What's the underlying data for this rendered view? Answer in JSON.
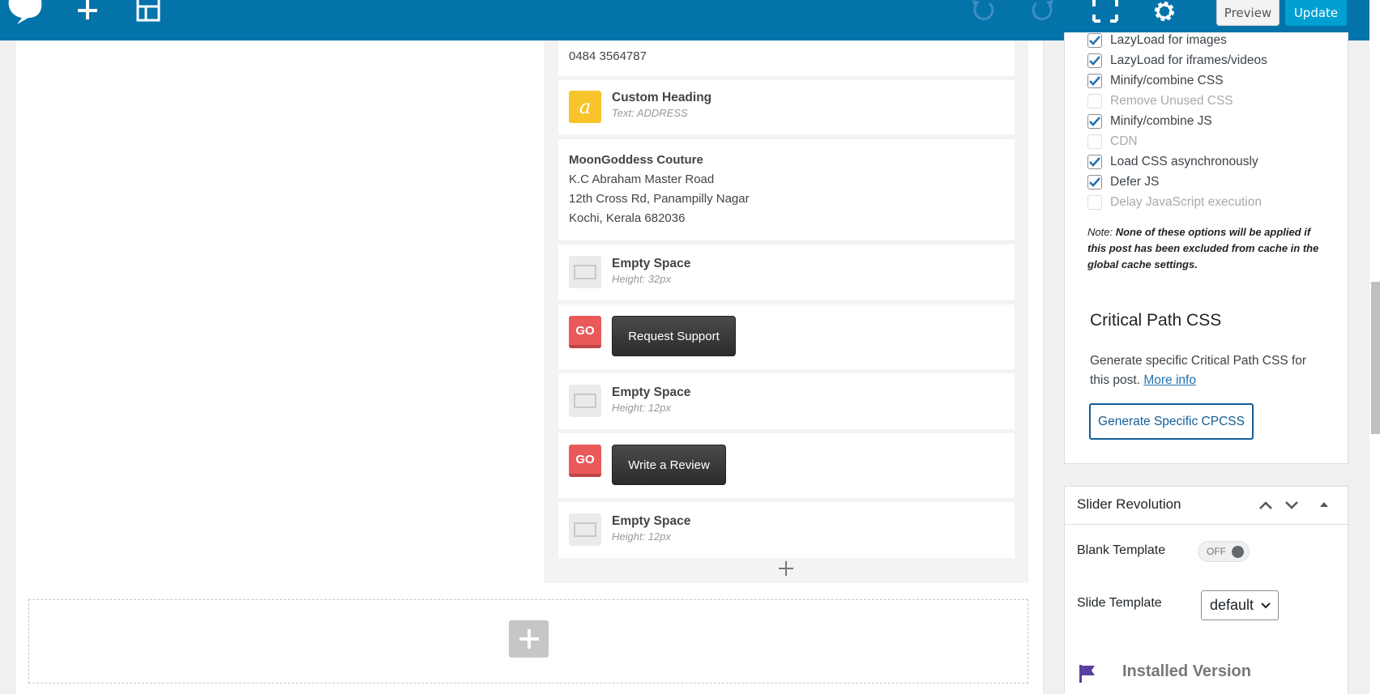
{
  "toolbar": {
    "preview_label": "Preview",
    "update_label": "Update",
    "icons": [
      "logo-icon",
      "add-element-icon",
      "templates-icon",
      "undo-icon",
      "redo-icon",
      "fullscreen-icon",
      "settings-icon"
    ]
  },
  "elements": {
    "phone_text": "0484 3564787",
    "custom_heading": {
      "title": "Custom Heading",
      "sub": "Text: ADDRESS",
      "icon_glyph": "a"
    },
    "address": {
      "line1": "MoonGoddess Couture",
      "line2": "K.C Abraham Master Road",
      "line3": "12th Cross Rd, Panampilly Nagar",
      "line4": "Kochi, Kerala 682036"
    },
    "space1": {
      "title": "Empty Space",
      "sub": "Height: 32px"
    },
    "btn_request": {
      "icon_label": "GO",
      "label": "Request Support"
    },
    "space2": {
      "title": "Empty Space",
      "sub": "Height: 12px"
    },
    "btn_review": {
      "icon_label": "GO",
      "label": "Write a Review"
    },
    "space3": {
      "title": "Empty Space",
      "sub": "Height: 12px"
    }
  },
  "sidebar": {
    "options": [
      {
        "label": "LazyLoad for images",
        "checked": true,
        "disabled": false
      },
      {
        "label": "LazyLoad for iframes/videos",
        "checked": true,
        "disabled": false
      },
      {
        "label": "Minify/combine CSS",
        "checked": true,
        "disabled": false
      },
      {
        "label": "Remove Unused CSS",
        "checked": false,
        "disabled": true
      },
      {
        "label": "Minify/combine JS",
        "checked": true,
        "disabled": false
      },
      {
        "label": "CDN",
        "checked": false,
        "disabled": true
      },
      {
        "label": "Load CSS asynchronously",
        "checked": true,
        "disabled": false
      },
      {
        "label": "Defer JS",
        "checked": true,
        "disabled": false
      },
      {
        "label": "Delay JavaScript execution",
        "checked": false,
        "disabled": true
      }
    ],
    "note_prefix": "Note:",
    "note_text": "None of these options will be applied if this post has been excluded from cache in the global cache settings.",
    "cpcss_title": "Critical Path CSS",
    "cpcss_desc": "Generate specific Critical Path CSS for this post.",
    "cpcss_link": "More info",
    "cpcss_button": "Generate Specific CPCSS",
    "slider": {
      "title": "Slider Revolution",
      "blank_template_label": "Blank Template",
      "toggle_label": "OFF",
      "slide_template_label": "Slide Template",
      "slide_template_value": "default",
      "installed_label": "Installed Version"
    }
  },
  "colors": {
    "topbar": "#0473aa",
    "update": "#00a0d2",
    "go": "#e9595a",
    "heading_icon": "#f7c52b"
  }
}
